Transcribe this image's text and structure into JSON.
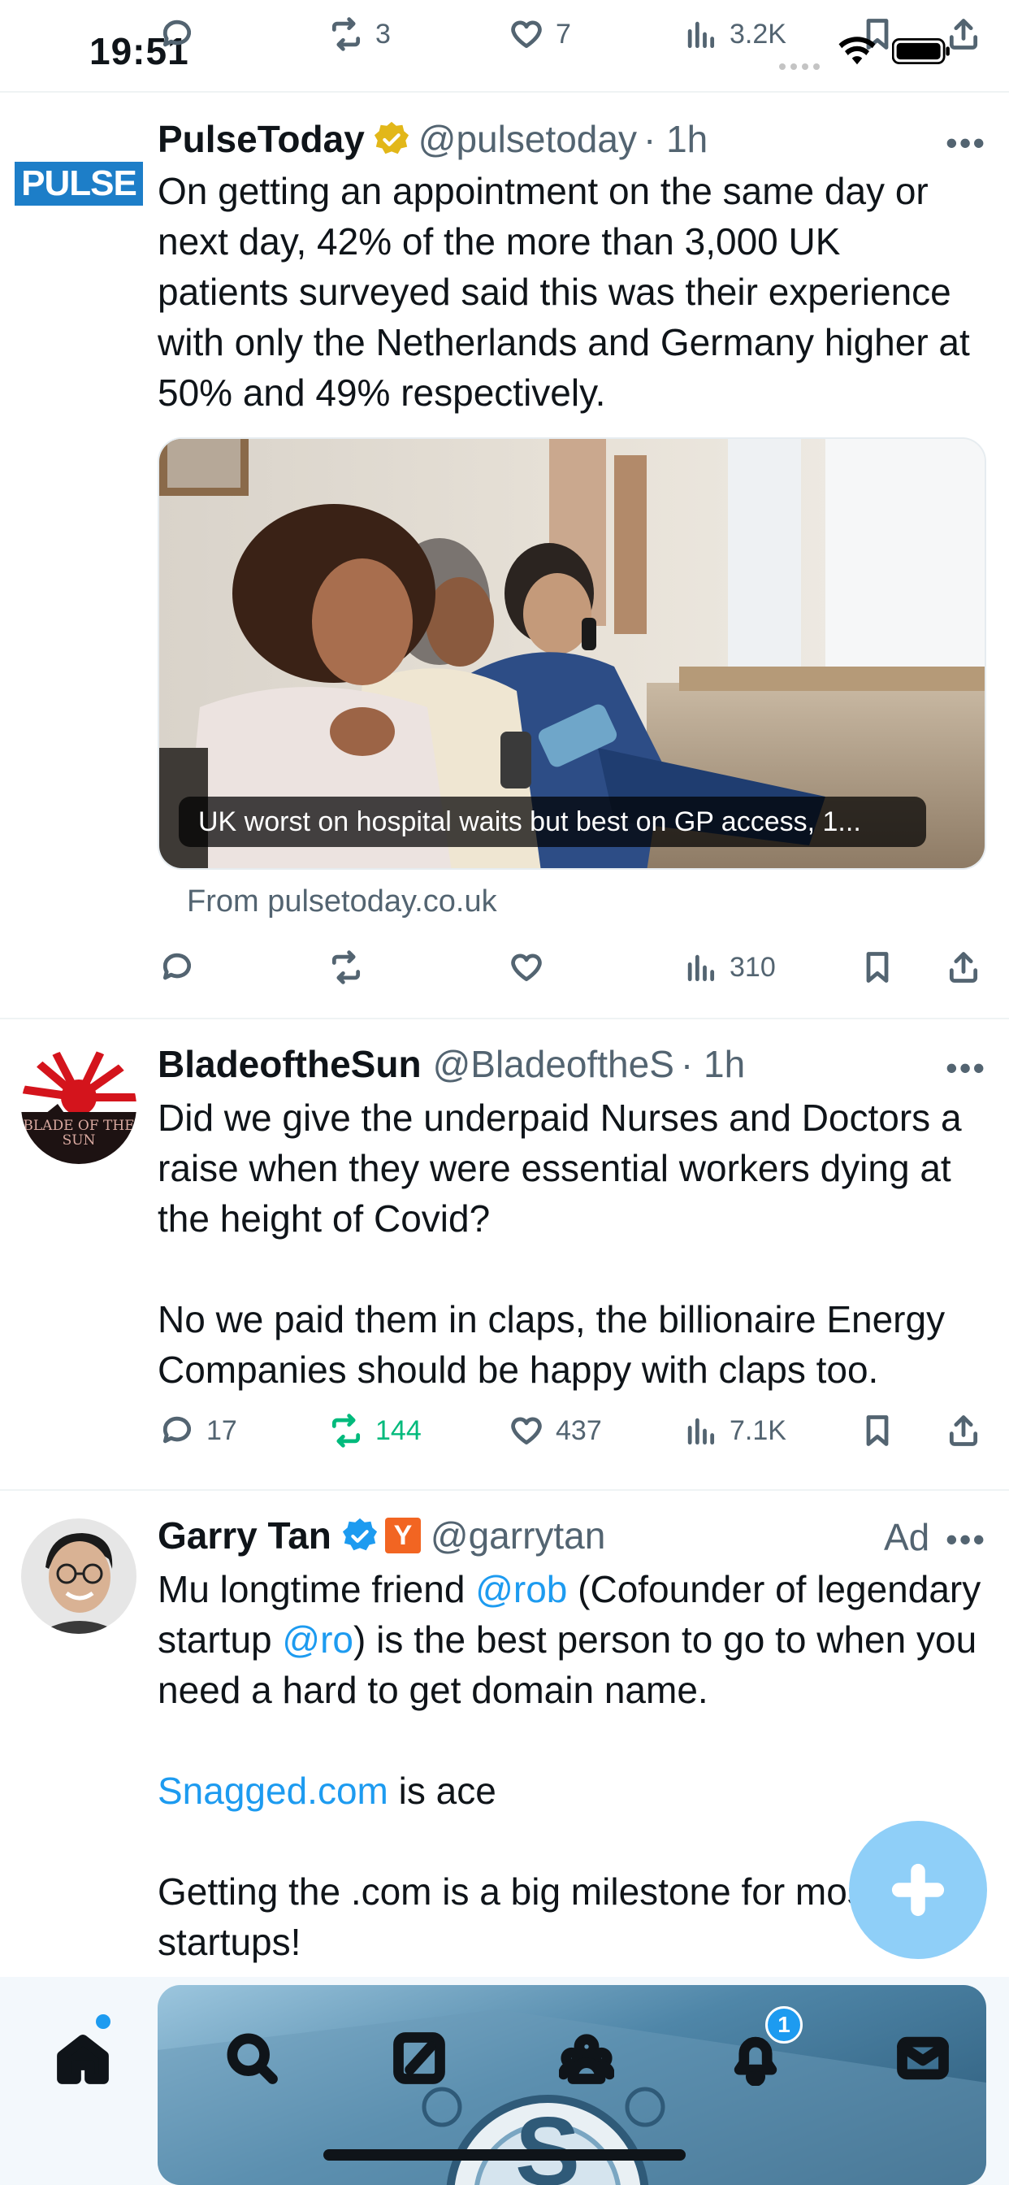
{
  "status_bar": {
    "time": "19:51"
  },
  "top_actions": {
    "reply_count": "",
    "repost_count": "3",
    "like_count": "7",
    "view_count": "3.2K"
  },
  "tweets": [
    {
      "name": "PulseToday",
      "handle": "@pulsetoday",
      "time": "· 1h",
      "avatar_text": "PULSE",
      "text": "On getting an appointment on the same day or next day, 42% of the more than 3,000 UK patients surveyed said this was their experience with only the Netherlands and Germany higher at 50% and 49% respectively.",
      "card_caption": "UK worst on hospital waits but best on GP access, 1...",
      "card_source": "From pulsetoday.co.uk",
      "views": "310",
      "verified_color": "#e2b719"
    },
    {
      "name": "BladeoftheSun",
      "handle": "@BladeoftheS",
      "time": "· 1h",
      "avatar_text": "BLADE OF THE SUN",
      "text_line1": "Did we give the underpaid Nurses and Doctors a raise when they were essential workers dying at the height of Covid?",
      "text_line2": "No we paid them in claps, the billionaire Energy Companies should be happy with claps too.",
      "replies": "17",
      "reposts": "144",
      "likes": "437",
      "views": "7.1K"
    },
    {
      "name": "Garry Tan",
      "handle": "@garrytan",
      "ad_label": "Ad",
      "badge_letter": "Y",
      "text_pre": "Mu longtime friend ",
      "mention1": "@rob",
      "text_mid": " (Cofounder of legendary startup ",
      "mention2": "@ro",
      "text_post": ") is the best person to go to when you need a hard to get domain name.",
      "link": "Snagged.com",
      "link_suffix": " is ace",
      "text_last": "Getting the .com is a big milestone for most startups!",
      "verified_color": "#1d9bf0"
    }
  ],
  "bottom_nav": {
    "items": [
      "home",
      "search",
      "grok",
      "communities",
      "notifications",
      "messages"
    ],
    "notifications_badge": "1"
  },
  "colors": {
    "accent": "#1d9bf0",
    "repost_active": "#00ba7c",
    "text_secondary": "#536471"
  }
}
